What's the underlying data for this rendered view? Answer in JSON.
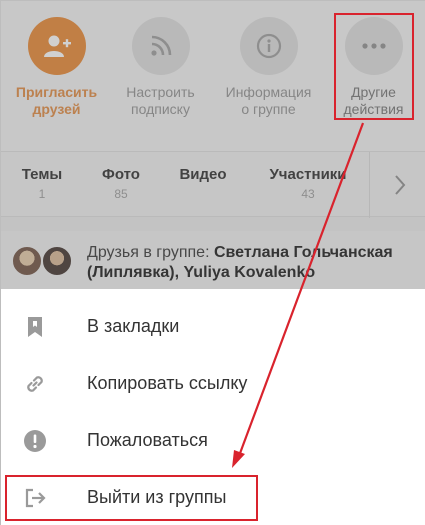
{
  "actions": [
    {
      "label": "Пригласить\nдрузей",
      "icon": "add-user-icon",
      "accent": "#e8832a"
    },
    {
      "label": "Настроить\nподписку",
      "icon": "rss-icon"
    },
    {
      "label": "Информация\nо группе",
      "icon": "info-icon"
    },
    {
      "label": "Другие\nдействия",
      "icon": "more-dots-icon"
    }
  ],
  "tabs": [
    {
      "name": "Темы",
      "count": "1"
    },
    {
      "name": "Фото",
      "count": "85"
    },
    {
      "name": "Видео",
      "count": ""
    },
    {
      "name": "Участники",
      "count": "43"
    }
  ],
  "friends": {
    "prefix": "Друзья в группе: ",
    "names": "Светлана Гольчанская (Липлявка), Yuliya Kovalenko"
  },
  "menu": [
    {
      "label": "В закладки",
      "icon": "bookmark-icon"
    },
    {
      "label": "Копировать ссылку",
      "icon": "link-icon"
    },
    {
      "label": "Пожаловаться",
      "icon": "report-icon"
    },
    {
      "label": "Выйти из группы",
      "icon": "exit-icon"
    }
  ],
  "colors": {
    "accent": "#e8832a",
    "annotation": "#d9232d"
  }
}
